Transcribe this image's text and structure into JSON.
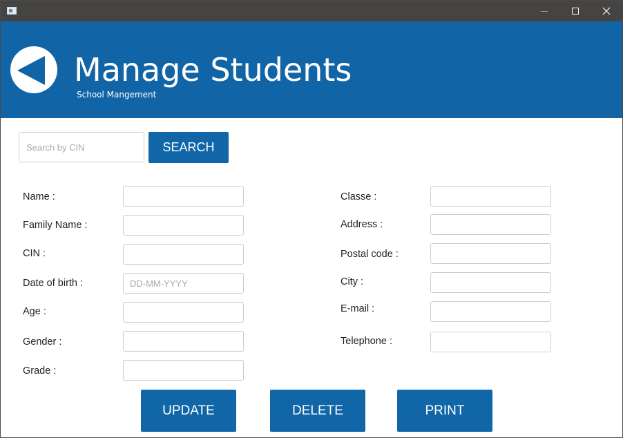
{
  "window": {
    "app_icon": "window-app-icon",
    "controls": [
      "minimize-icon",
      "maximize-icon",
      "close-icon"
    ]
  },
  "header": {
    "title": "Manage Students",
    "subtitle": "School Mangement",
    "back_icon": "back-arrow-icon",
    "background_color": "#1165a6"
  },
  "search": {
    "placeholder": "Search by CIN",
    "value": "",
    "button_label": "SEARCH"
  },
  "form": {
    "left": [
      {
        "label": "Name :",
        "value": "",
        "placeholder": ""
      },
      {
        "label": "Family Name :",
        "value": "",
        "placeholder": ""
      },
      {
        "label": "CIN :",
        "value": "",
        "placeholder": ""
      },
      {
        "label": "Date of birth :",
        "value": "",
        "placeholder": "DD-MM-YYYY"
      },
      {
        "label": "Age :",
        "value": "",
        "placeholder": ""
      },
      {
        "label": "Gender :",
        "value": "",
        "placeholder": ""
      },
      {
        "label": "Grade :",
        "value": "",
        "placeholder": ""
      }
    ],
    "right": [
      {
        "label": "Classe :",
        "value": "",
        "placeholder": ""
      },
      {
        "label": "Address :",
        "value": "",
        "placeholder": ""
      },
      {
        "label": "Postal code :",
        "value": "",
        "placeholder": ""
      },
      {
        "label": "City :",
        "value": "",
        "placeholder": ""
      },
      {
        "label": "E-mail :",
        "value": "",
        "placeholder": ""
      },
      {
        "label": "Telephone :",
        "value": "",
        "placeholder": ""
      }
    ]
  },
  "actions": {
    "update": "UPDATE",
    "delete": "DELETE",
    "print": "PRINT",
    "button_color": "#1166a8"
  }
}
